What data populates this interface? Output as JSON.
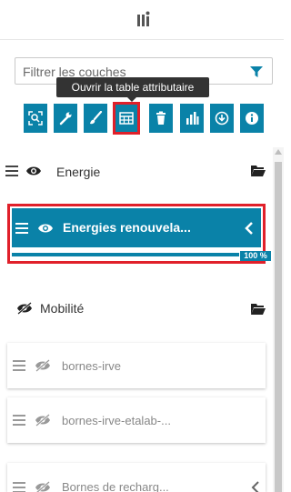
{
  "header": {
    "icon": "layers-icon"
  },
  "filter": {
    "placeholder": "Filtrer les couches",
    "icon": "funnel-icon"
  },
  "tooltip": {
    "text": "Ouvrir la table attributaire"
  },
  "toolbar": {
    "buttons": [
      {
        "icon": "zoom-extent-icon"
      },
      {
        "icon": "wrench-icon"
      },
      {
        "icon": "brush-icon"
      },
      {
        "icon": "table-icon",
        "active": true
      },
      {
        "icon": "trash-icon"
      },
      {
        "icon": "bar-chart-icon"
      },
      {
        "icon": "download-icon"
      },
      {
        "icon": "info-icon"
      }
    ]
  },
  "layers": {
    "energie": {
      "label": "Energie"
    },
    "selected": {
      "label": "Energies renouvela...",
      "progress_label": "100 %",
      "progress": 1.0
    },
    "mobilite": {
      "label": "Mobilité"
    },
    "items": [
      {
        "label": "bornes-irve"
      },
      {
        "label": "bornes-irve-etalab-..."
      },
      {
        "label": "Bornes de recharg..."
      }
    ]
  },
  "colors": {
    "accent": "#0a82a8",
    "highlight": "#e0202a",
    "tooltip": "#333333"
  }
}
